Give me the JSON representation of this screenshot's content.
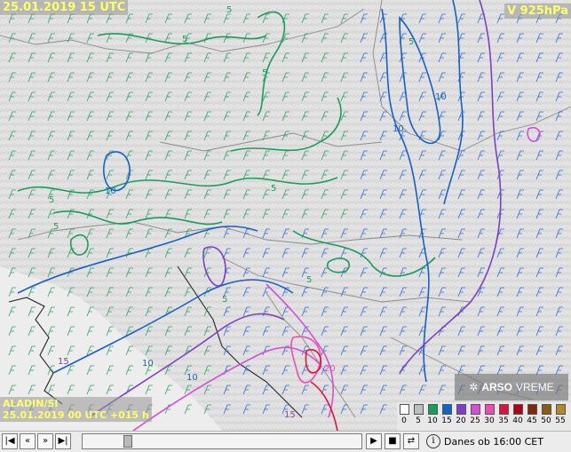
{
  "map": {
    "timestamp": "25.01.2019 15 UTC",
    "level_label": "V 925hPa",
    "model_name": "ALADIN/SI",
    "model_run": "25.01.2019 00 UTC +015 h",
    "logo_text": "ARSO",
    "logo_suffix": "VREME",
    "contour_labels": [
      "5",
      "5",
      "5",
      "5",
      "5",
      "5",
      "5",
      "5",
      "5",
      "10",
      "10",
      "10",
      "10",
      "10",
      "15",
      "15",
      "20"
    ]
  },
  "legend": {
    "values": [
      "0",
      "5",
      "10",
      "15",
      "20",
      "25",
      "30",
      "35",
      "40",
      "45",
      "50",
      "55"
    ],
    "colors": [
      "#ffffff",
      "#bebebe",
      "#1a9c5a",
      "#1560c8",
      "#7d3fc4",
      "#d24fd6",
      "#f04bb0",
      "#e0123c",
      "#b00018",
      "#7b2a10",
      "#8a5a18",
      "#b08830"
    ]
  },
  "controls": {
    "first_icon": "skip-to-start-icon",
    "prev_icon": "step-back-icon",
    "next_icon": "step-forward-icon",
    "last_icon": "skip-to-end-icon",
    "play_icon": "play-icon",
    "stop_icon": "stop-icon",
    "loop_icon": "loop-icon",
    "info_icon": "info-icon",
    "status_text": "Danes ob 16:00 CET",
    "slider_fraction": 0.15
  }
}
